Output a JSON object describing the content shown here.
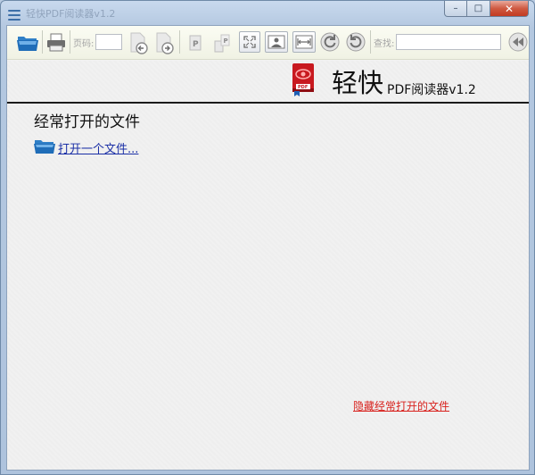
{
  "window": {
    "title": "轻快PDF阅读器v1.2",
    "controls": {
      "minimize": "–",
      "maximize": "□",
      "close": "✕"
    }
  },
  "toolbar": {
    "page_label": "页码:",
    "page_value": "",
    "search_label": "查找:",
    "search_value": "",
    "icons": [
      "open-folder-icon",
      "print-icon",
      "prev-page-icon",
      "next-page-icon",
      "single-page-icon",
      "continuous-page-icon",
      "fullscreen-icon",
      "fit-page-icon",
      "fit-width-icon",
      "rotate-left-icon",
      "rotate-right-icon",
      "collapse-panel-icon"
    ]
  },
  "brand": {
    "name": "轻快",
    "subtitle": "PDF阅读器v1.2",
    "logo_badge": "PDF"
  },
  "recent": {
    "title": "经常打开的文件",
    "open_link": "打开一个文件...",
    "hide_link": "隐藏经常打开的文件"
  },
  "colors": {
    "link_blue": "#1a2fa6",
    "hide_red": "#d8211d",
    "logo_red": "#c8191f",
    "toolbar_bg": "#f7f8ec"
  }
}
